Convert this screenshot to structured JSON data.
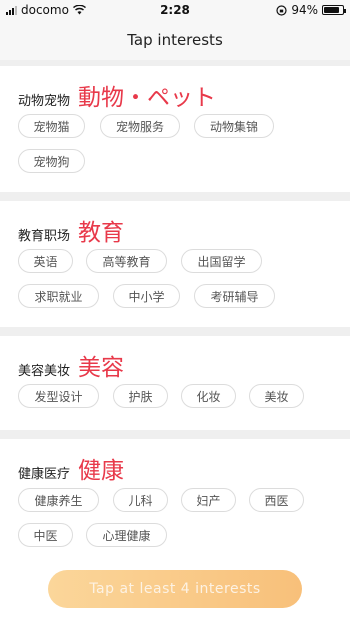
{
  "status_bar": {
    "carrier": "docomo",
    "time": "2:28",
    "battery": "94%",
    "battery_level": 0.94,
    "icons": [
      "signal-icon",
      "wifi-icon",
      "orientation-lock-icon",
      "battery-icon"
    ]
  },
  "header": {
    "title": "Tap interests"
  },
  "sections": [
    {
      "label": "动物宠物",
      "big": "動物・ペット",
      "tags": [
        "宠物猫",
        "宠物服务",
        "动物集锦",
        "宠物狗"
      ]
    },
    {
      "label": "教育职场",
      "big": "教育",
      "tags": [
        "英语",
        "高等教育",
        "出国留学",
        "求职就业",
        "中小学",
        "考研辅导"
      ]
    },
    {
      "label": "美容美妆",
      "big": "美容",
      "tags": [
        "发型设计",
        "护肤",
        "化妆",
        "美妆"
      ]
    },
    {
      "label": "健康医疗",
      "big": "健康",
      "tags": [
        "健康养生",
        "儿科",
        "妇产",
        "西医",
        "中医",
        "心理健康"
      ]
    }
  ],
  "cta": {
    "label": "Tap at least 4 interests"
  },
  "colors": {
    "accent": "#e8394a",
    "cta_start": "#fbd69a",
    "cta_end": "#f8c07a"
  }
}
